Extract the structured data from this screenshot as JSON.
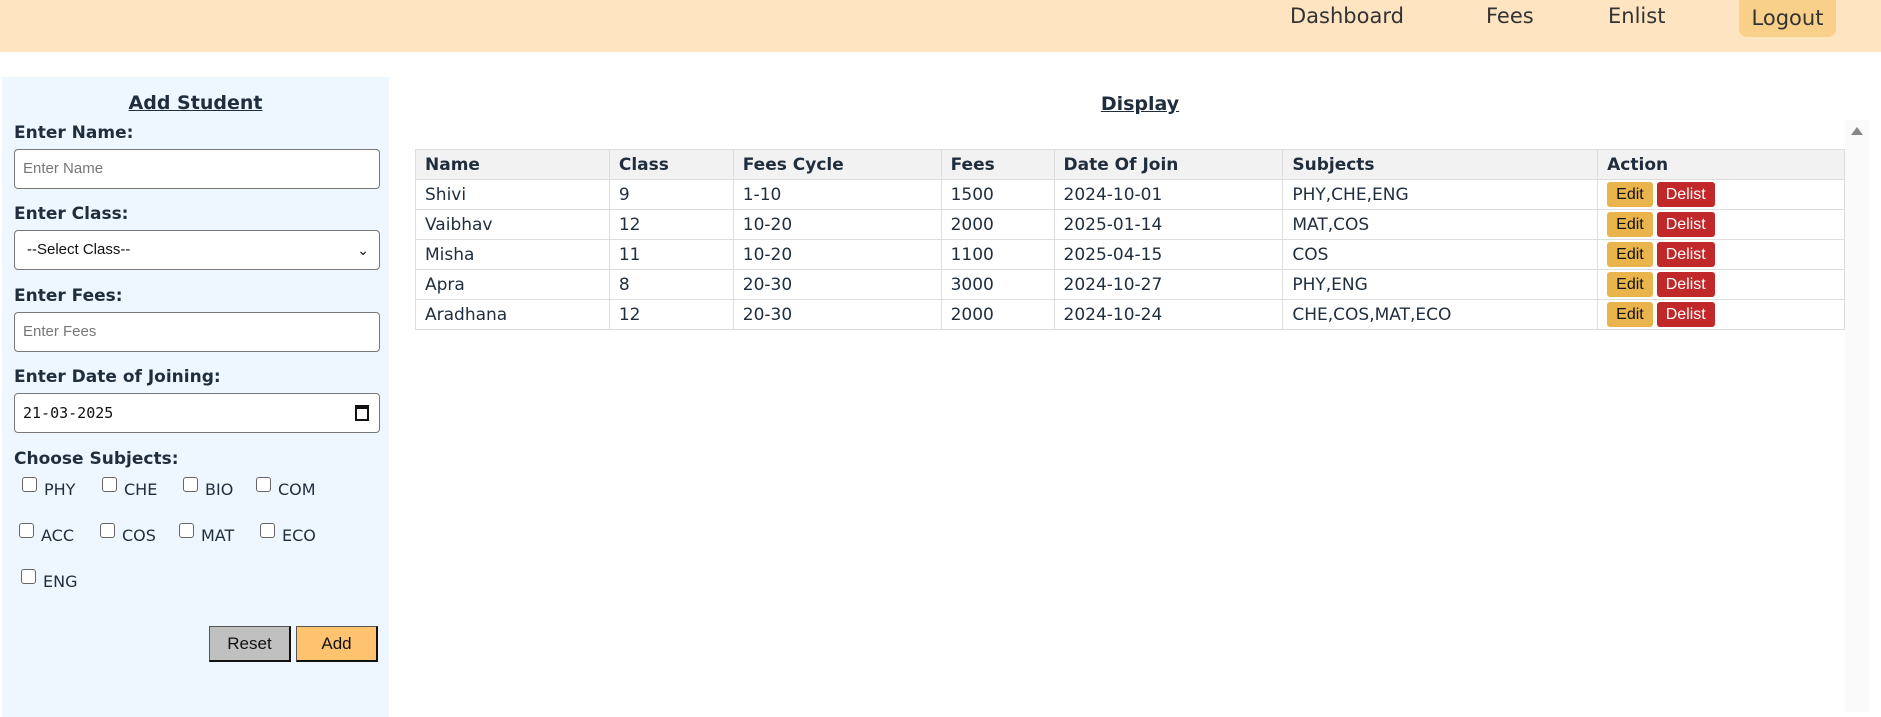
{
  "nav": {
    "items": [
      "Dashboard",
      "Fees",
      "Enlist"
    ],
    "logout": "Logout"
  },
  "form": {
    "title": "Add Student",
    "name_label": "Enter Name:",
    "name_placeholder": "Enter Name",
    "class_label": "Enter Class:",
    "class_selected": "--Select Class--",
    "fees_label": "Enter Fees:",
    "fees_placeholder": "Enter Fees",
    "date_label": "Enter Date of Joining:",
    "date_value": "21-03-2025",
    "subjects_label": "Choose Subjects:",
    "subjects": [
      "PHY",
      "CHE",
      "BIO",
      "COM",
      "ACC",
      "COS",
      "MAT",
      "ECO",
      "ENG"
    ],
    "reset": "Reset",
    "add": "Add"
  },
  "display": {
    "title": "Display",
    "columns": [
      "Name",
      "Class",
      "Fees Cycle",
      "Fees",
      "Date Of Join",
      "Subjects",
      "Action"
    ],
    "rows": [
      [
        "Shivi",
        "9",
        "1-10",
        "1500",
        "2024-10-01",
        "PHY,CHE,ENG"
      ],
      [
        "Vaibhav",
        "12",
        "10-20",
        "2000",
        "2025-01-14",
        "MAT,COS"
      ],
      [
        "Misha",
        "11",
        "10-20",
        "1100",
        "2025-04-15",
        "COS"
      ],
      [
        "Apra",
        "8",
        "20-30",
        "3000",
        "2024-10-27",
        "PHY,ENG"
      ],
      [
        "Aradhana",
        "12",
        "20-30",
        "2000",
        "2024-10-24",
        "CHE,COS,MAT,ECO"
      ]
    ],
    "edit": "Edit",
    "delist": "Delist"
  },
  "colors": {
    "header": "#ffe4c2",
    "sidebar": "#eef6ff",
    "edit": "#e9b44c",
    "delist": "#c0282a",
    "add": "#ffc26e"
  }
}
